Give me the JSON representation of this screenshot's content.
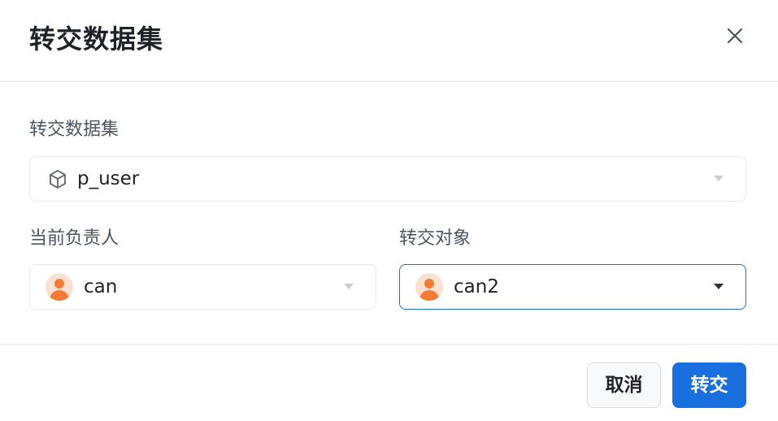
{
  "dialog": {
    "title": "转交数据集"
  },
  "dataset_field": {
    "label": "转交数据集",
    "value": "p_user",
    "icon": "cube-icon"
  },
  "current_owner_field": {
    "label": "当前负责人",
    "value": "can",
    "icon": "user-avatar-icon"
  },
  "transfer_target_field": {
    "label": "转交对象",
    "value": "can2",
    "icon": "user-avatar-icon"
  },
  "footer": {
    "cancel_label": "取消",
    "confirm_label": "转交"
  },
  "colors": {
    "primary": "#1a6fde",
    "avatar_bg": "#fde0d0",
    "avatar_fg": "#f47b35",
    "border": "#e8eaed"
  }
}
